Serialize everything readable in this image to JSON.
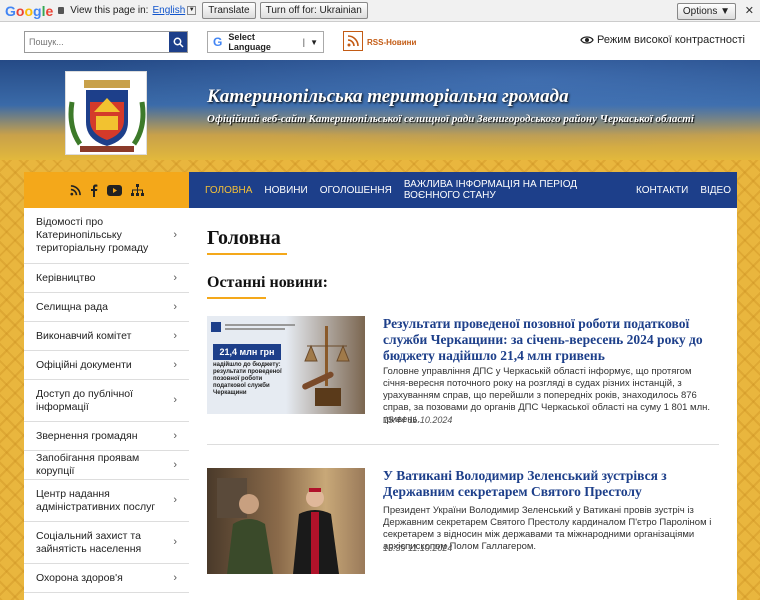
{
  "gtranslate": {
    "logo": "Google",
    "view_label": "View this page in:",
    "language": "English",
    "translate_btn": "Translate",
    "turnoff_btn": "Turn off for: Ukrainian",
    "options_btn": "Options ▼",
    "close": "✕"
  },
  "topbar": {
    "search_placeholder": "Пошук...",
    "select_language": "Select Language",
    "rss_label": "RSS-Новини",
    "contrast_label": "Режим високої контрастності"
  },
  "header": {
    "title": "Катеринопільська територіальна громада",
    "subtitle": "Офіційний веб-сайт Катеринопільської селищної ради Звенигородського району Черкаської області"
  },
  "sidebar": {
    "items": [
      {
        "label": "Відомості про Катеринопільську територіальну громаду"
      },
      {
        "label": "Керівництво"
      },
      {
        "label": "Селищна рада"
      },
      {
        "label": "Виконавчий комітет"
      },
      {
        "label": "Офіційні документи"
      },
      {
        "label": "Доступ до публічної інформації"
      },
      {
        "label": "Звернення громадян"
      },
      {
        "label": "Запобігання проявам корупції"
      },
      {
        "label": "Центр надання адміністративних послуг"
      },
      {
        "label": "Соціальний захист та зайнятість населення"
      },
      {
        "label": "Охорона здоров'я"
      }
    ]
  },
  "nav": {
    "items": [
      "ГОЛОВНА",
      "НОВИНИ",
      "ОГОЛОШЕННЯ",
      "ВАЖЛИВА ІНФОРМАЦІЯ НА ПЕРІОД ВОЄННОГО СТАНУ",
      "КОНТАКТИ",
      "ВІДЕО"
    ]
  },
  "main": {
    "page_title": "Головна",
    "section_title": "Останні новини:",
    "news": [
      {
        "title": "Результати проведеної позовної роботи податкової служби Черкащини: за січень-вересень 2024 року до бюджету надійшло 21,4 млн гривень",
        "text": "Головне управління ДПС у Черкаській області інформує, що протягом січня-вересня поточного року на розгляді в судах різних інстанцій, з урахуванням справ, що перейшли з попередніх років, знаходилось 876 справ, за позовами до органів ДПС Черкаської області на суму 1 801 млн. гривень.",
        "date": "15:44 11.10.2024",
        "image_amount": "21,4 млн грн",
        "image_caption": "надійшло до бюджету: результати проведеної позовної роботи податкової служби Черкащини"
      },
      {
        "title": "У Ватикані Володимир Зеленський зустрівся з Державним секретарем Святого Престолу",
        "text": "Президент України Володимир Зеленський у Ватикані провів зустріч із Державним секретарем Святого Престолу кардиналом П'єтро Пароліном і секретарем з відносин між державами та міжнародними організаціями архієпископом Полом Галлагером.",
        "date": "15:39 11.10.2024"
      }
    ]
  }
}
